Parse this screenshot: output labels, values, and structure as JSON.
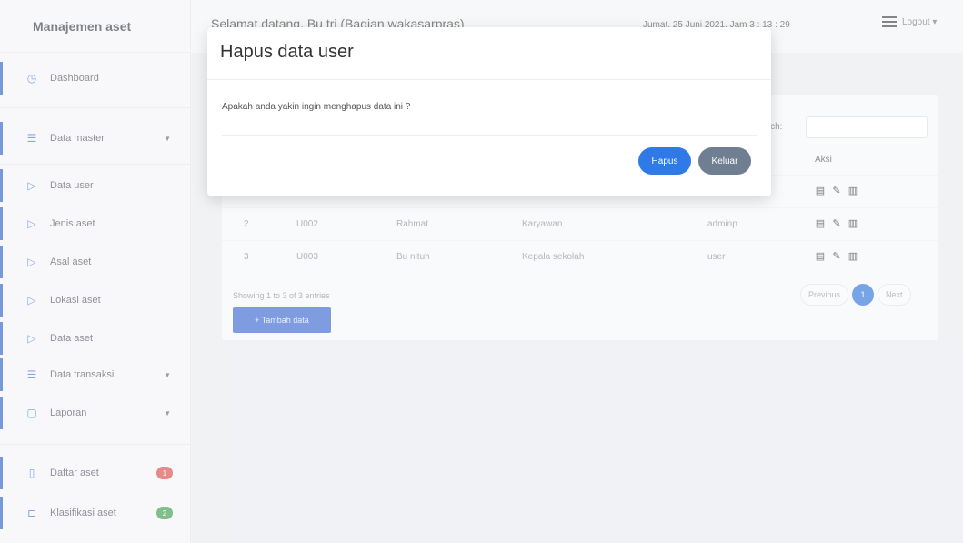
{
  "brand": "Manajemen aset",
  "header": {
    "welcome": "Selamat datang, Bu tri (Bagian wakasarpras)",
    "datetime": "Jumat, 25 Juni 2021, Jam 3 : 13 : 29",
    "logout": "Logout ▾"
  },
  "sidebar": {
    "dashboard": "Dashboard",
    "data_master": "Data master",
    "data_user": "Data user",
    "jenis_aset": "Jenis aset",
    "asal_aset": "Asal aset",
    "lokasi_aset": "Lokasi aset",
    "data_aset": "Data aset",
    "data_transaksi": "Data transaksi",
    "laporan": "Laporan",
    "daftar_aset": "Daftar aset",
    "klasifikasi_aset": "Klasifikasi aset",
    "daftar_badge": "1",
    "klasifikasi_badge": "2"
  },
  "colors": {
    "badge_red": "#dc4a4a",
    "badge_green": "#3e9c4d",
    "primary": "#2f7ae6"
  },
  "table": {
    "search_label": "Search:",
    "col_aksi": "Aksi",
    "rows": [
      {
        "no": "2",
        "id": "U002",
        "nama": "Rahmat",
        "jabatan": "Karyawan",
        "level": "adminp"
      },
      {
        "no": "3",
        "id": "U003",
        "nama": "Bu nituh",
        "jabatan": "Kepala sekolah",
        "level": "user"
      }
    ],
    "info": "Showing 1 to 3 of 3 entries",
    "add_button": "+ Tambah data",
    "prev": "Previous",
    "current_page": "1",
    "next": "Next"
  },
  "modal": {
    "title": "Hapus data user",
    "message": "Apakah anda yakin ingin menghapus data ini ?",
    "confirm": "Hapus",
    "cancel": "Keluar"
  }
}
